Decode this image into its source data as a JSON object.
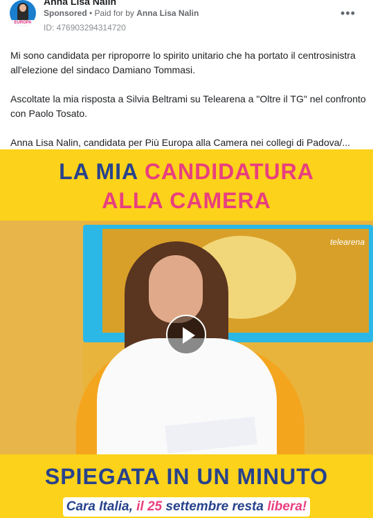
{
  "post": {
    "author_name": "Anna Lisa Nalin",
    "avatar_tag": "EUROPA",
    "sponsored_label": "Sponsored",
    "paid_for_prefix": " • Paid for by ",
    "paid_for_name": "Anna Lisa Nalin",
    "ad_id": "ID: 476903294314720",
    "more_label": "•••"
  },
  "caption": {
    "paragraph_1": "Mi sono candidata per riproporre lo spirito unitario che ha portato il centrosinistra all'elezione del sindaco Damiano Tommasi.",
    "paragraph_2": "Ascoltate la mia risposta a Silvia Beltrami su Telearena a \"Oltre il TG\" nel confronto con Paolo Tosato.",
    "paragraph_3": "Anna Lisa Nalin, candidata per Più Europa alla Camera nei collegi di Padova/..."
  },
  "creative": {
    "headline_part1": "LA MIA ",
    "headline_part2": "CANDIDATURA",
    "headline_line2": "ALLA CAMERA",
    "video_watermark": "telearena",
    "bottom_headline": "SPIEGATA IN UN MINUTO",
    "banner_part1": "Cara Italia, ",
    "banner_part2": "il 25",
    "banner_part3": " settembre resta ",
    "banner_part4": "libera!"
  },
  "colors": {
    "creative_bg": "#fcd21a",
    "navy": "#27428c",
    "pink": "#e83f7f"
  }
}
